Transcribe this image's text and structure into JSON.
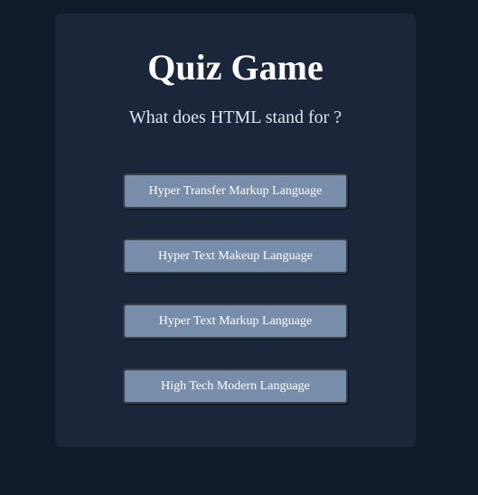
{
  "quiz": {
    "title": "Quiz Game",
    "question": "What does HTML stand for ?",
    "answers": [
      "Hyper Transfer Markup Language",
      "Hyper Text Makeup Language",
      "Hyper Text Markup Language",
      "High Tech Modern Language"
    ]
  },
  "colors": {
    "page_background": "#0f1a2a",
    "card_background": "#1b263b",
    "button_background": "#778da9",
    "title_text": "#ffffff",
    "question_text": "#dfe5ee"
  }
}
